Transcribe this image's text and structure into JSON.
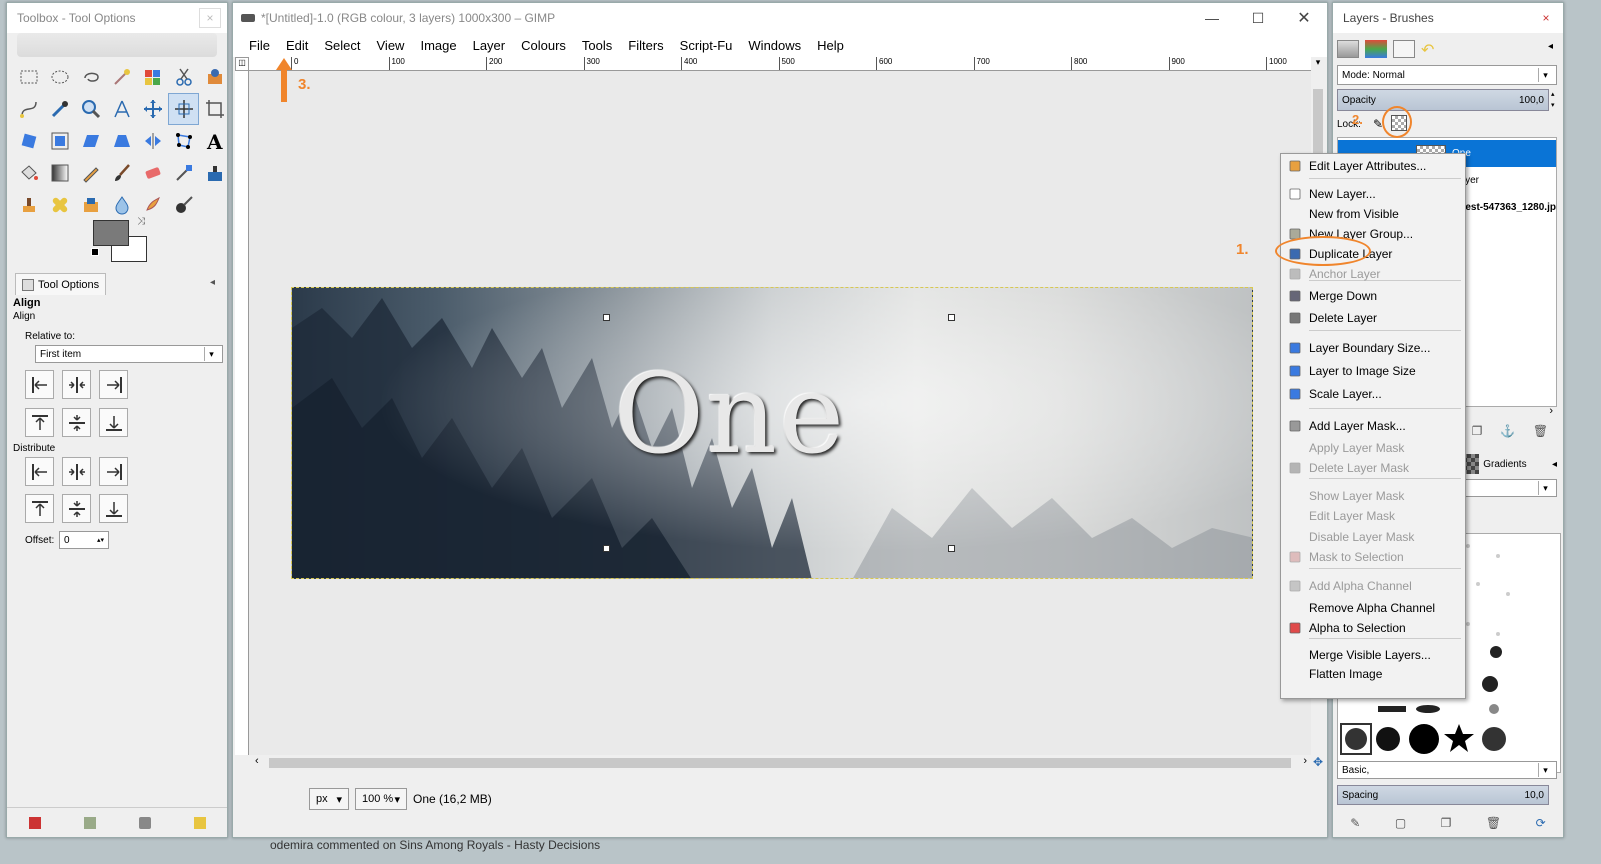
{
  "toolbox": {
    "title": "Toolbox - Tool Options",
    "close": "×",
    "panel_tab": "Tool Options",
    "section_title": "Align",
    "section_sub": "Align",
    "relative_to_label": "Relative to:",
    "relative_to_value": "First item",
    "distribute_label": "Distribute",
    "offset_label": "Offset:",
    "offset_value": "0"
  },
  "image_window": {
    "title": "*[Untitled]-1.0 (RGB colour, 3 layers) 1000x300 – GIMP",
    "menu": [
      "File",
      "Edit",
      "Select",
      "View",
      "Image",
      "Layer",
      "Colours",
      "Tools",
      "Filters",
      "Script-Fu",
      "Windows",
      "Help"
    ],
    "ruler_marks": [
      "0",
      "100",
      "200",
      "300",
      "400",
      "500",
      "600",
      "700",
      "800",
      "900",
      "1000"
    ],
    "canvas_text": "One",
    "unit": "px",
    "zoom": "100 %",
    "status": "One (16,2 MB)"
  },
  "layers_panel": {
    "title": "Layers - Brushes",
    "close": "×",
    "mode_label": "Mode: Normal",
    "opacity_label": "Opacity",
    "opacity_value": "100,0",
    "lock_label": "Lock:",
    "layers": [
      "One",
      "Layer",
      "forest-547363_1280.jp"
    ],
    "tab_patterns": "terns",
    "tab_gradients": "Gradients",
    "brush_preset": "Basic,",
    "spacing_label": "Spacing",
    "spacing_value": "10,0"
  },
  "context_menu": {
    "items": [
      {
        "label": "Edit Layer Attributes...",
        "disabled": false
      },
      {
        "label": "New Layer...",
        "disabled": false
      },
      {
        "label": "New from Visible",
        "disabled": false
      },
      {
        "label": "New Layer Group...",
        "disabled": false
      },
      {
        "label": "Duplicate Layer",
        "disabled": false
      },
      {
        "label": "Anchor Layer",
        "disabled": true
      },
      {
        "label": "Merge Down",
        "disabled": false
      },
      {
        "label": "Delete Layer",
        "disabled": false
      },
      {
        "label": "Layer Boundary Size...",
        "disabled": false
      },
      {
        "label": "Layer to Image Size",
        "disabled": false
      },
      {
        "label": "Scale Layer...",
        "disabled": false
      },
      {
        "label": "Add Layer Mask...",
        "disabled": false
      },
      {
        "label": "Apply Layer Mask",
        "disabled": true
      },
      {
        "label": "Delete Layer Mask",
        "disabled": true
      },
      {
        "label": "Show Layer Mask",
        "disabled": true
      },
      {
        "label": "Edit Layer Mask",
        "disabled": true
      },
      {
        "label": "Disable Layer Mask",
        "disabled": true
      },
      {
        "label": "Mask to Selection",
        "disabled": true
      },
      {
        "label": "Add Alpha Channel",
        "disabled": true
      },
      {
        "label": "Remove Alpha Channel",
        "disabled": false
      },
      {
        "label": "Alpha to Selection",
        "disabled": false
      },
      {
        "label": "Merge Visible Layers...",
        "disabled": false
      },
      {
        "label": "Flatten Image",
        "disabled": false
      }
    ]
  },
  "annotations": {
    "one": "1.",
    "two": "2.",
    "three": "3."
  },
  "background_text": "odemira commented on Sins Among Royals - Hasty Decisions",
  "colors": {
    "annotation": "#f0852c",
    "selection": "#0a74d6"
  }
}
